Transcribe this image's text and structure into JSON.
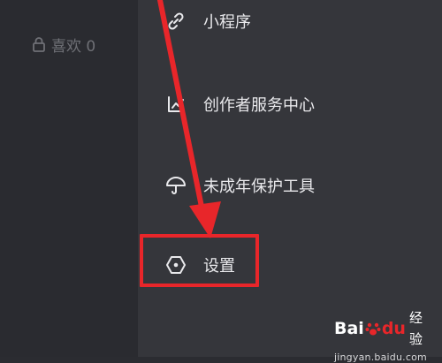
{
  "sidebar": {
    "likes_label": "喜欢 0"
  },
  "menu": {
    "items": [
      {
        "label": "小程序",
        "icon": "link-icon"
      },
      {
        "label": "创作者服务中心",
        "icon": "chart-icon"
      },
      {
        "label": "未成年保护工具",
        "icon": "umbrella-icon"
      },
      {
        "label": "设置",
        "icon": "hexagon-settings-icon"
      }
    ]
  },
  "annotation": {
    "arrow_color": "#e8262a",
    "box_color": "#e8262a"
  },
  "watermark": {
    "brand_prefix": "Bai",
    "brand_suffix": "du",
    "product": "经验",
    "url": "jingyan.baidu.com"
  }
}
